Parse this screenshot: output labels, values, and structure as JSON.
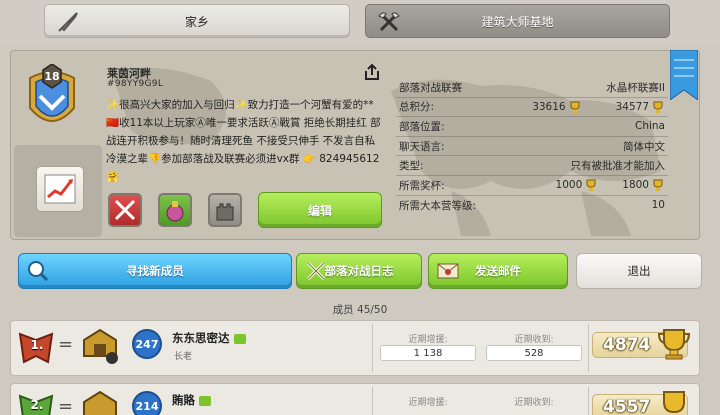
{
  "tabs": {
    "home": "家乡",
    "builder": "建筑大师基地"
  },
  "clan": {
    "level": "18",
    "name": "莱茵河畔",
    "tag": "#98YY9G9L",
    "description": "✨很高兴大家的加入与回归✨致力打造一个河蟹有爱的**🇨🇳收11本以上玩家Ⓐ唯一要求活跃Ⓐ戰賞 拒绝长期挂红 部战连开积极参与！随时清理死鱼 不接受只伸手 不发言自私冷漠之辈👎参加部落战及联赛必须进vx群 👉 824945612🤗",
    "edit_label": "编辑"
  },
  "info_rows": [
    {
      "label": "部落对战联赛",
      "value": "水晶杯联赛II"
    },
    {
      "label": "总积分:",
      "value": "33616",
      "value2": "34577"
    },
    {
      "label": "部落位置:",
      "value": "China"
    },
    {
      "label": "聊天语言:",
      "value": "简体中文"
    },
    {
      "label": "类型:",
      "value": "只有被批准才能加入"
    },
    {
      "label": "所需奖杯:",
      "value": "1000",
      "value2": "1800"
    },
    {
      "label": "所需大本营等级:",
      "value": "10"
    }
  ],
  "actions": {
    "find": "寻找新成员",
    "war_log": "部落对战日志",
    "mail": "发送邮件",
    "leave": "退出"
  },
  "members_label": "成员 45/50",
  "members": [
    {
      "rank": "1.",
      "change": "=",
      "level": "247",
      "name": "东东思密达",
      "role": "长老",
      "donated_label": "近期增援:",
      "donated": "1 138",
      "received_label": "近期收到:",
      "received": "528",
      "trophies": "4874"
    },
    {
      "rank": "2.",
      "change": "=",
      "level": "214",
      "name": "賄賂",
      "role": "",
      "donated_label": "近期增援:",
      "donated": "",
      "received_label": "近期收到:",
      "received": "",
      "trophies": "4557"
    }
  ],
  "colors": {
    "accent_green": "#7cc42c",
    "accent_blue": "#2c9fe0",
    "trophy_gold": "#e6d49b"
  }
}
